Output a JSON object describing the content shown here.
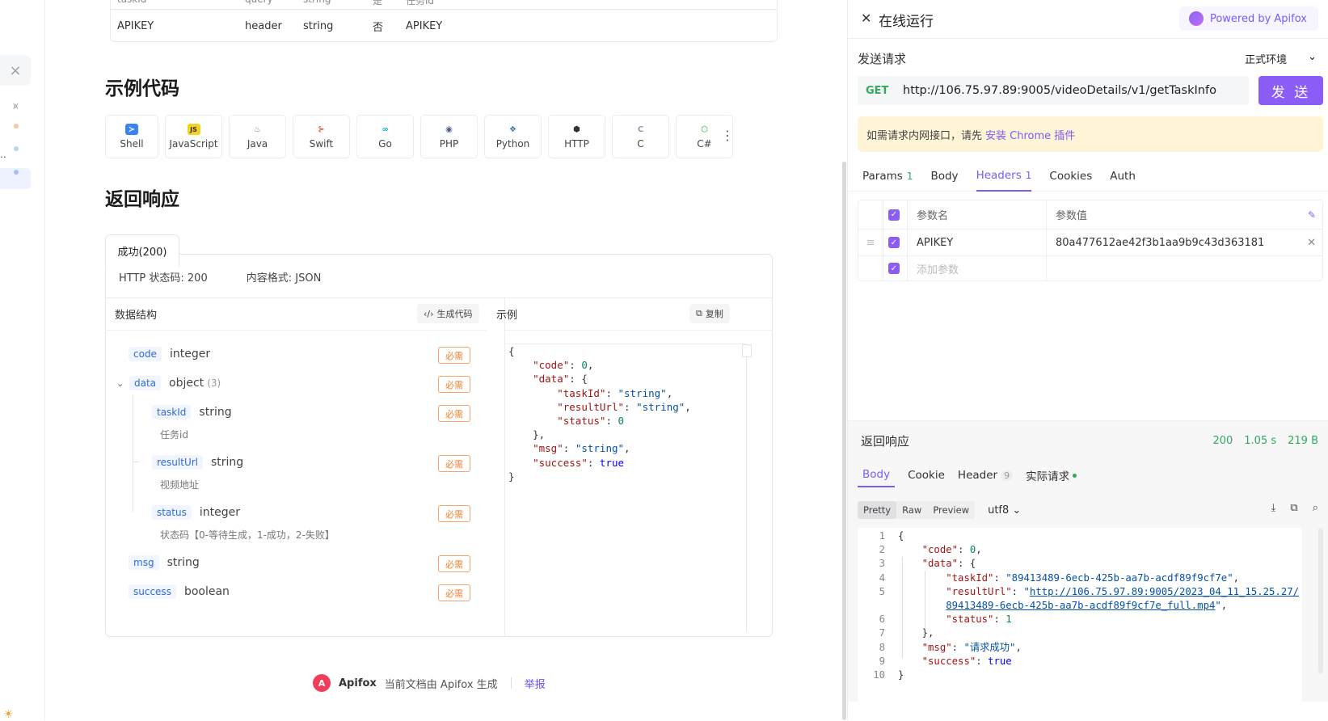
{
  "top_table": {
    "prev_row": [
      "taskId",
      "query",
      "string",
      "是",
      "任务id"
    ],
    "row": {
      "name": "APIKEY",
      "location": "header",
      "type": "string",
      "required": "否",
      "desc": "APIKEY"
    }
  },
  "sections": {
    "example_code": "示例代码",
    "response": "返回响应"
  },
  "languages": [
    {
      "label": "Shell",
      "icon": "shell-icon",
      "glyph": "≻",
      "color": "#3b82f6"
    },
    {
      "label": "JavaScript",
      "icon": "javascript-icon",
      "glyph": "JS",
      "color": "#f4d21f"
    },
    {
      "label": "Java",
      "icon": "java-icon",
      "glyph": "♨",
      "color": "#5b7fbf"
    },
    {
      "label": "Swift",
      "icon": "swift-icon",
      "glyph": "⊱",
      "color": "#f05138"
    },
    {
      "label": "Go",
      "icon": "go-icon",
      "glyph": "∞",
      "color": "#00add8"
    },
    {
      "label": "PHP",
      "icon": "php-icon",
      "glyph": "◉",
      "color": "#4f5b93"
    },
    {
      "label": "Python",
      "icon": "python-icon",
      "glyph": "❖",
      "color": "#3776ab"
    },
    {
      "label": "HTTP",
      "icon": "http-icon",
      "glyph": "⬢",
      "color": "#333333"
    },
    {
      "label": "C",
      "icon": "c-icon",
      "glyph": "C",
      "color": "#8a9bb5"
    },
    {
      "label": "C#",
      "icon": "csharp-icon",
      "glyph": "⬡",
      "color": "#2ea043"
    }
  ],
  "response_doc": {
    "tab": "成功(200)",
    "status": "HTTP 状态码: 200",
    "format": "内容格式: JSON",
    "schema_title": "数据结构",
    "gen_code": "生成代码",
    "example_title": "示例",
    "copy": "复制",
    "required_label": "必需",
    "fields": [
      {
        "name": "code",
        "type": "integer",
        "desc": ""
      },
      {
        "name": "data",
        "type": "object",
        "count": "(3)",
        "desc": ""
      },
      {
        "name": "taskId",
        "type": "string",
        "desc": "任务id"
      },
      {
        "name": "resultUrl",
        "type": "string",
        "desc": "视频地址"
      },
      {
        "name": "status",
        "type": "integer",
        "desc": "状态码【0-等待生成，1-成功，2-失败】"
      },
      {
        "name": "msg",
        "type": "string",
        "desc": ""
      },
      {
        "name": "success",
        "type": "boolean",
        "desc": ""
      }
    ]
  },
  "footer": {
    "brand": "Apifox",
    "text": "当前文档由 Apifox 生成",
    "report": "举报"
  },
  "panel": {
    "title": "在线运行",
    "powered": "Powered by Apifox",
    "send_label": "发送请求",
    "env": "正式环境",
    "method": "GET",
    "url": "http://106.75.97.89:9005/videoDetails/v1/getTaskInfo",
    "send_button": "发 送",
    "notice": "如需请求内网接口，请先",
    "notice_link": "安装 Chrome 插件",
    "tabs": [
      {
        "label": "Params",
        "count": "1"
      },
      {
        "label": "Body",
        "count": ""
      },
      {
        "label": "Headers",
        "count": "1"
      },
      {
        "label": "Cookies",
        "count": ""
      },
      {
        "label": "Auth",
        "count": ""
      }
    ],
    "headers_table": {
      "col_name": "参数名",
      "col_value": "参数值",
      "rows": [
        {
          "name": "APIKEY",
          "value": "80a477612ae42f3b1aa9b9c43d363181"
        }
      ],
      "add_placeholder": "添加参数"
    },
    "response": {
      "title": "返回响应",
      "status": "200",
      "time": "1.05 s",
      "size": "219 B",
      "tabs": [
        {
          "label": "Body",
          "count": ""
        },
        {
          "label": "Cookie",
          "count": ""
        },
        {
          "label": "Header",
          "count": "9"
        },
        {
          "label": "实际请求",
          "count": ""
        }
      ],
      "formats": [
        "Pretty",
        "Raw",
        "Preview"
      ],
      "encoding": "utf8",
      "line_numbers": [
        "1",
        "2",
        "3",
        "4",
        "5",
        "",
        "6",
        "7",
        "8",
        "9",
        "10"
      ],
      "body": {
        "code": "0",
        "taskId": "\"89413489-6ecb-425b-aa7b-acdf89f9cf7e\"",
        "resultUrl_part1": "http://106.75.97.89:9005/2023_04_11_15.25.27/",
        "resultUrl_part2": "89413489-6ecb-425b-aa7b-acdf89f9cf7e_full.mp4",
        "status": "1",
        "msg": "\"请求成功\"",
        "success": "true"
      }
    }
  }
}
